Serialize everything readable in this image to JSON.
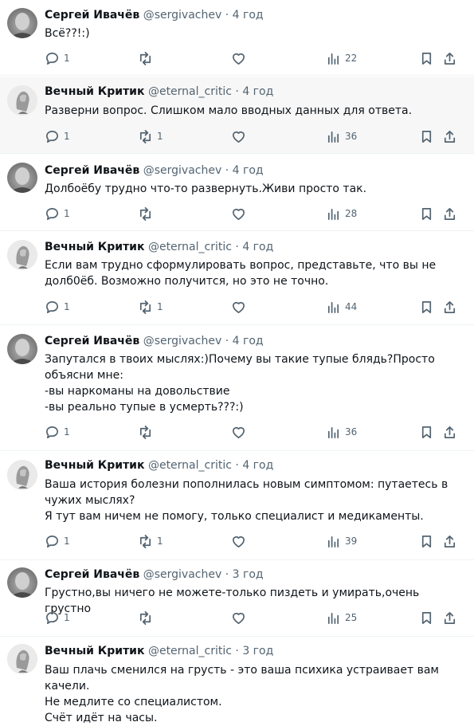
{
  "tweets": [
    {
      "author": "Сергей Ивачёв",
      "handle": "@sergivachev",
      "dot": "·",
      "time": "4 год",
      "text": "Всё??!:)",
      "replies": "1",
      "retweets": "",
      "views": "22"
    },
    {
      "author": "Вечный Критик",
      "handle": "@eternal_critic",
      "dot": "·",
      "time": "4 год",
      "text": "Разверни вопрос. Слишком мало вводных данных для ответа.",
      "replies": "1",
      "retweets": "1",
      "views": "36"
    },
    {
      "author": "Сергей Ивачёв",
      "handle": "@sergivachev",
      "dot": "·",
      "time": "4 год",
      "text": "Долбоёбу трудно что-то развернуть.Живи просто так.",
      "replies": "1",
      "retweets": "",
      "views": "28"
    },
    {
      "author": "Вечный Критик",
      "handle": "@eternal_critic",
      "dot": "·",
      "time": "4 год",
      "text": "Если вам трудно сформулировать вопрос, представьте, что вы не\nдолб0ёб. Возможно получится, но это не точно.",
      "replies": "1",
      "retweets": "1",
      "views": "44"
    },
    {
      "author": "Сергей Ивачёв",
      "handle": "@sergivachev",
      "dot": "·",
      "time": "4 год",
      "text": "Запутался в твоих мыслях:)Почему вы такие тупые блядь?Просто\nобъясни мне:\n-вы наркоманы на довольствие\n-вы реально тупые в усмерть???:)",
      "replies": "1",
      "retweets": "",
      "views": "36"
    },
    {
      "author": "Вечный Критик",
      "handle": "@eternal_critic",
      "dot": "·",
      "time": "4 год",
      "text": "Ваша история болезни пополнилась новым симптомом: путаетесь в\nчужих мыслях?\nЯ тут вам ничем не помогу, только специалист и медикаменты.",
      "replies": "1",
      "retweets": "1",
      "views": "39"
    },
    {
      "author": "Сергей Ивачёв",
      "handle": "@sergivachev",
      "dot": "·",
      "time": "3 год",
      "text": "Грустно,вы ничего не можете-только пиздеть и умирать,очень грустно",
      "replies": "1",
      "retweets": "",
      "views": "25"
    },
    {
      "author": "Вечный Критик",
      "handle": "@eternal_critic",
      "dot": "·",
      "time": "3 год",
      "text": "Ваш плачь сменился на грусть - это ваша психика устраивает вам качели.\nНе медлите со специалистом.\nСчёт идёт на часы.",
      "replies": "",
      "retweets": "",
      "views": ""
    }
  ]
}
